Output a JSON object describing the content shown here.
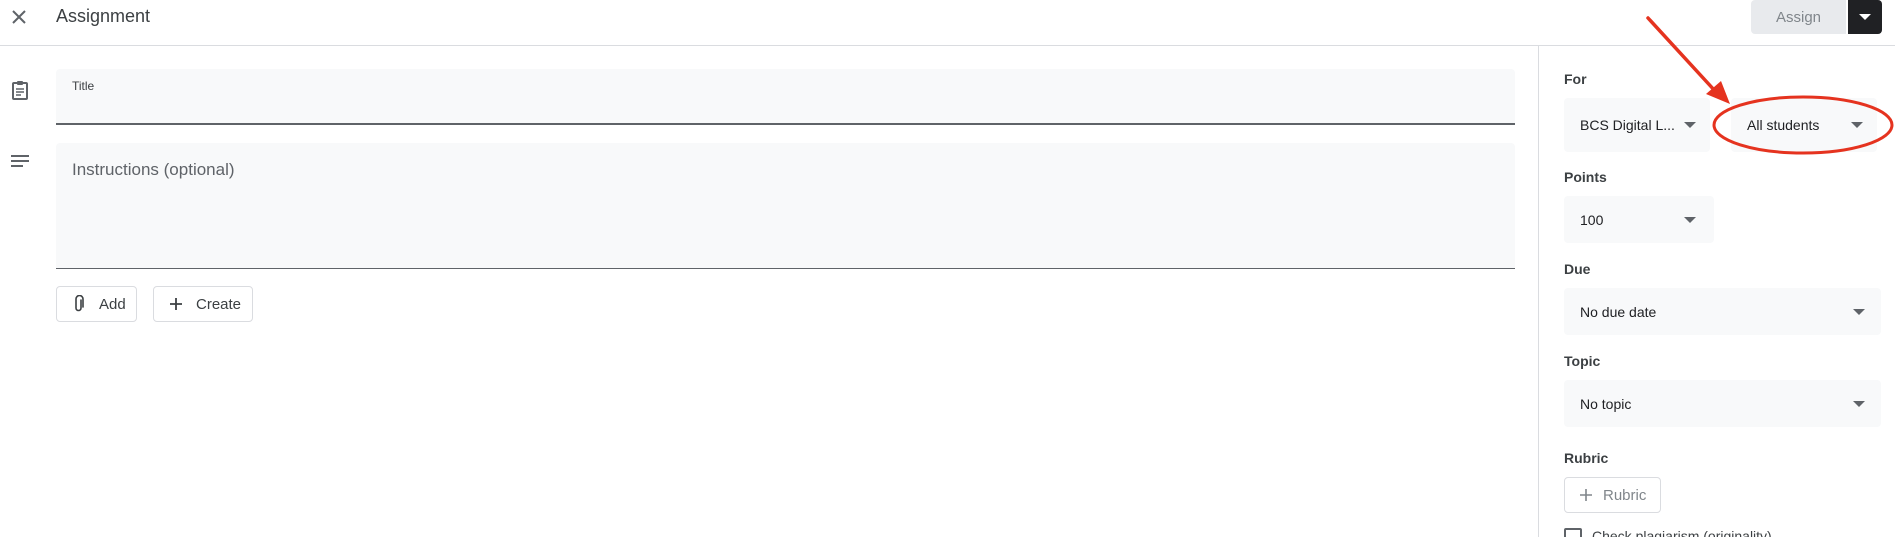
{
  "header": {
    "title": "Assignment",
    "assign_label": "Assign"
  },
  "form": {
    "title_label": "Title",
    "title_value": "",
    "instructions_placeholder": "Instructions (optional)",
    "add_label": "Add",
    "create_label": "Create"
  },
  "sidebar": {
    "for_label": "For",
    "class_value": "BCS Digital L...",
    "students_value": "All students",
    "points_label": "Points",
    "points_value": "100",
    "due_label": "Due",
    "due_value": "No due date",
    "topic_label": "Topic",
    "topic_value": "No topic",
    "rubric_label": "Rubric",
    "rubric_button_label": "Rubric",
    "plagiarism_label": "Check plagiarism (originality)",
    "plagiarism_checked": false
  },
  "annotation": {
    "color": "#e5331f",
    "shapes": [
      "arrow",
      "ellipse"
    ]
  },
  "colors": {
    "primary_dark": "#202124",
    "field_bg": "#f8f9fa",
    "divider": "#dadce0",
    "disabled_bg": "#e8eaed"
  },
  "icons": [
    "close-icon",
    "assignment-clipboard-icon",
    "notes-lines-icon",
    "paperclip-icon",
    "plus-icon",
    "dropdown-caret-icon"
  ]
}
